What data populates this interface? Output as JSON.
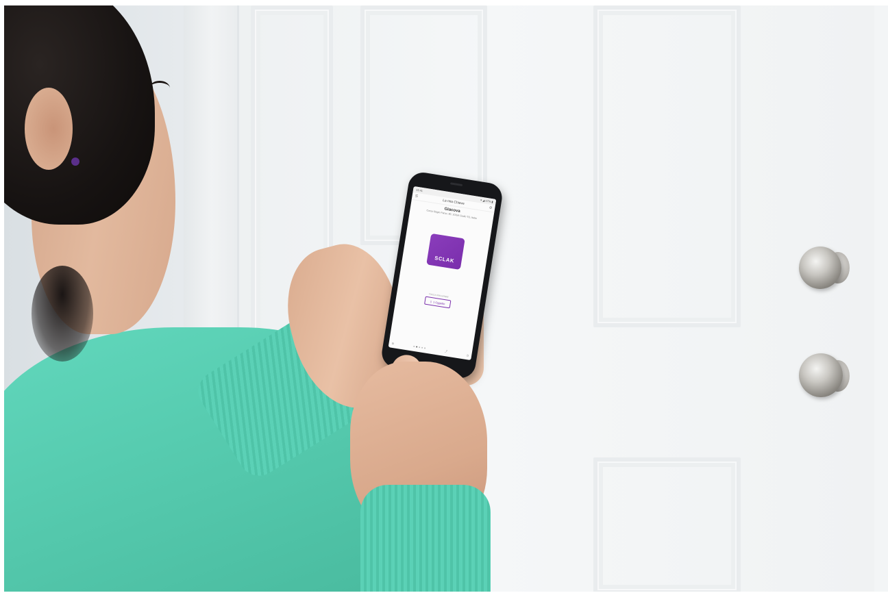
{
  "phone_app": {
    "status_time": "13:41",
    "status_icons": "▾ ◢ 47% ▮",
    "menu_icon": "hamburger-icon",
    "app_title": "La mia Chiave",
    "settings_icon": "gear-icon",
    "place_name": "Giacova",
    "place_address": "Corso Regio Parco, 80, 10154 Giulio TO, Italia",
    "logo_text": "SCLAK",
    "hint_text": "TOCCA PER APRIRE",
    "open_button_label": "1 Oggetto",
    "bottom_left_icon": "settings-icon",
    "bottom_right_icons": [
      "share-icon",
      "history-icon"
    ]
  },
  "colors": {
    "brand_purple": "#7a2eac",
    "sweater_teal": "#57ccb0",
    "door_white": "#f2f4f5"
  }
}
